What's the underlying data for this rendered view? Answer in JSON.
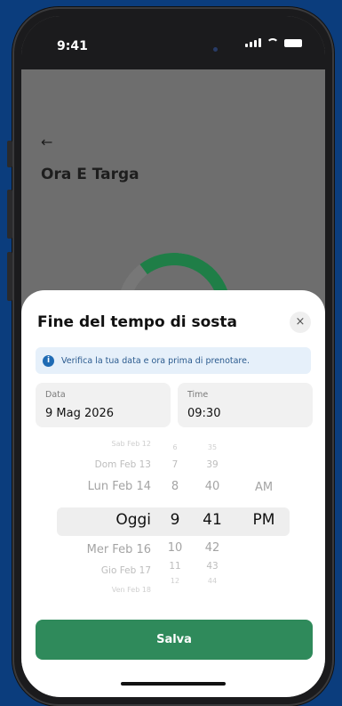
{
  "status_bar": {
    "time": "9:41"
  },
  "background_screen": {
    "back_icon": "arrow-left",
    "title": "Ora E Targa"
  },
  "sheet": {
    "title": "Fine del tempo di sosta",
    "close_icon": "×",
    "info": {
      "icon": "i",
      "text": "Verifica la tua data e ora prima di prenotare."
    },
    "date_field": {
      "label": "Data",
      "value": "9 Mag 2026"
    },
    "time_field": {
      "label": "Time",
      "value": "09:30"
    },
    "picker": {
      "days": [
        "Sab Feb 12",
        "Dom Feb 13",
        "Lun Feb 14",
        "Oggi",
        "Mer Feb 16",
        "Gio Feb 17",
        "Ven Feb 18"
      ],
      "hours": [
        "6",
        "7",
        "8",
        "9",
        "10",
        "11",
        "12"
      ],
      "minutes": [
        "35",
        "39",
        "40",
        "41",
        "42",
        "43",
        "44"
      ],
      "periods": [
        "AM",
        "PM"
      ],
      "selected": {
        "day": "Oggi",
        "hour": "9",
        "minute": "41",
        "period": "PM"
      }
    },
    "save_label": "Salva"
  },
  "colors": {
    "accent_green": "#2f8a5b",
    "info_blue": "#1f6bb4",
    "background": "#0b3d7d"
  }
}
